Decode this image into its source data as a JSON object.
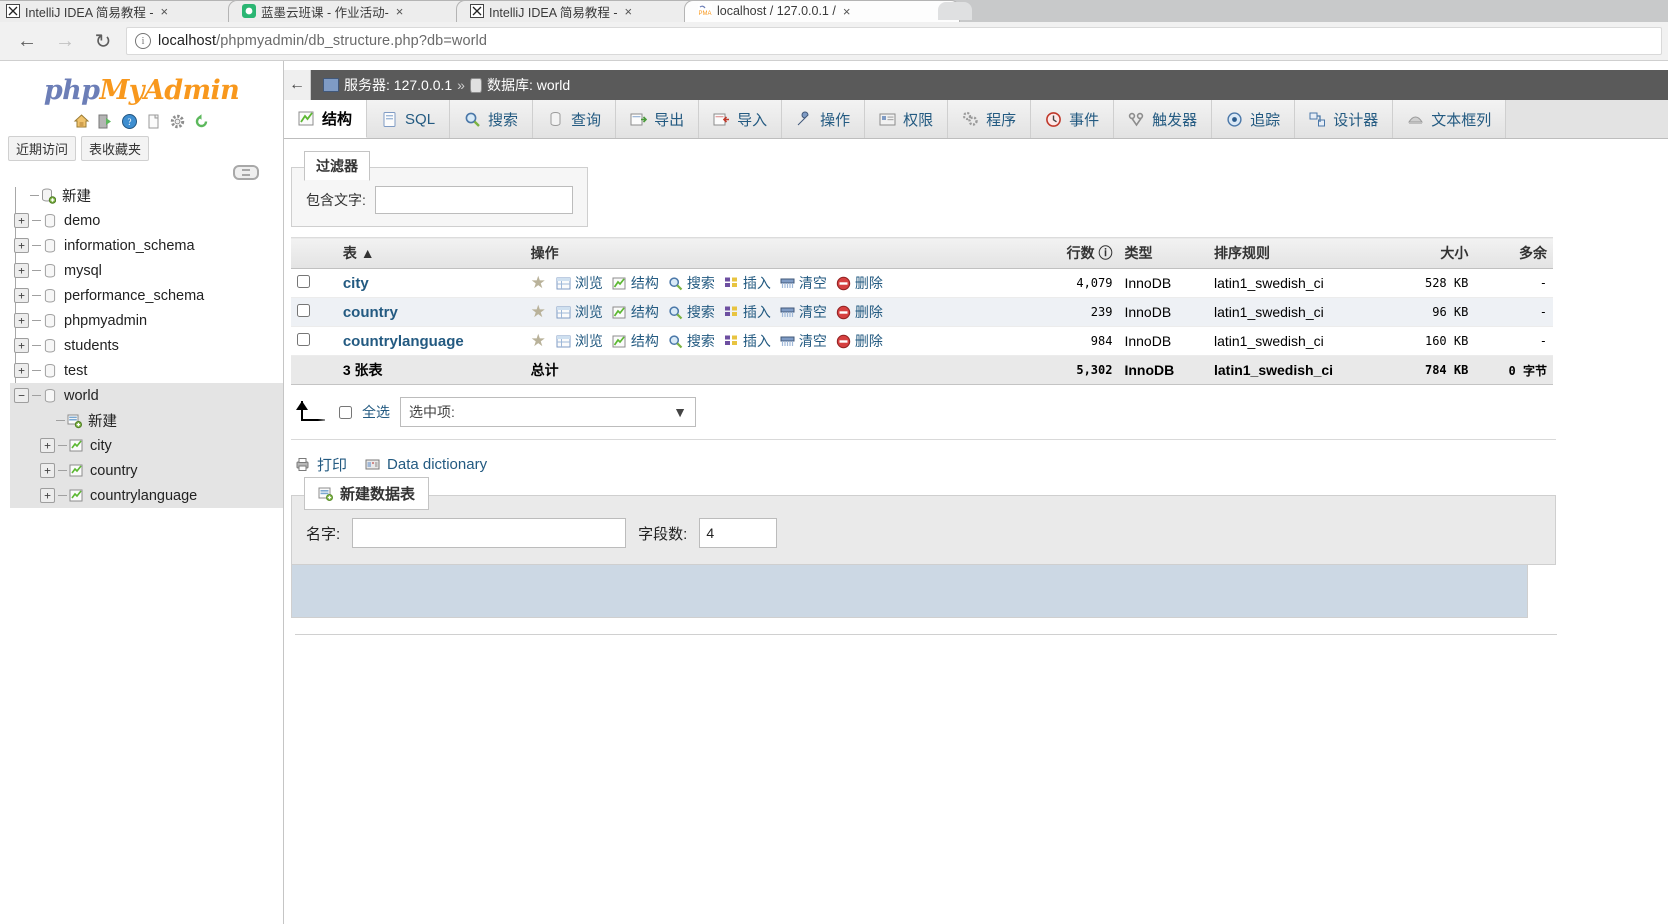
{
  "browser": {
    "tabs": [
      {
        "title": "IntelliJ IDEA 简易教程 -",
        "favicon": "idea-icon",
        "active": false
      },
      {
        "title": "蓝墨云班课 - 作业活动-",
        "favicon": "mosoteach-icon",
        "active": false
      },
      {
        "title": "IntelliJ IDEA 简易教程 -",
        "favicon": "idea-icon",
        "active": false
      },
      {
        "title": "localhost / 127.0.0.1 /",
        "favicon": "pma-icon",
        "active": true
      }
    ],
    "close_label": "×",
    "nav": {
      "back_icon": "back-arrow-icon",
      "forward_icon": "forward-arrow-icon",
      "reload_icon": "reload-icon",
      "info_icon": "info-icon",
      "url_prefix": "localhost",
      "url_rest": "/phpmyadmin/db_structure.php?db=world"
    }
  },
  "sidebar": {
    "logo": {
      "part1": "php",
      "part2": "My",
      "part3": "Admin"
    },
    "quick_icons": [
      "home-icon",
      "logout-icon",
      "docs-icon",
      "wiki-icon",
      "settings-icon",
      "reload-nav-icon"
    ],
    "quick_tabs": [
      {
        "label": "近期访问"
      },
      {
        "label": "表收藏夹"
      }
    ],
    "chain_icon": "chain-icon",
    "tree": [
      {
        "label": "新建",
        "icon": "new-db-icon",
        "expander": "",
        "level": 0,
        "selected": false
      },
      {
        "label": "demo",
        "icon": "db-icon",
        "expander": "+",
        "level": 0,
        "selected": false
      },
      {
        "label": "information_schema",
        "icon": "db-icon",
        "expander": "+",
        "level": 0,
        "selected": false
      },
      {
        "label": "mysql",
        "icon": "db-icon",
        "expander": "+",
        "level": 0,
        "selected": false
      },
      {
        "label": "performance_schema",
        "icon": "db-icon",
        "expander": "+",
        "level": 0,
        "selected": false
      },
      {
        "label": "phpmyadmin",
        "icon": "db-icon",
        "expander": "+",
        "level": 0,
        "selected": false
      },
      {
        "label": "students",
        "icon": "db-icon",
        "expander": "+",
        "level": 0,
        "selected": false
      },
      {
        "label": "test",
        "icon": "db-icon",
        "expander": "+",
        "level": 0,
        "selected": false
      },
      {
        "label": "world",
        "icon": "db-icon",
        "expander": "−",
        "level": 0,
        "selected": true
      },
      {
        "label": "新建",
        "icon": "new-table-icon",
        "expander": "",
        "level": 1,
        "selected": true
      },
      {
        "label": "city",
        "icon": "table-icon",
        "expander": "+",
        "level": 1,
        "selected": true
      },
      {
        "label": "country",
        "icon": "table-icon",
        "expander": "+",
        "level": 1,
        "selected": true
      },
      {
        "label": "countrylanguage",
        "icon": "table-icon",
        "expander": "+",
        "level": 1,
        "selected": true
      }
    ]
  },
  "breadcrumb": {
    "back_icon": "back-arrow-icon",
    "server_icon": "server-icon",
    "server_label": "服务器: 127.0.0.1",
    "separator": "»",
    "db_icon": "database-icon",
    "db_label": "数据库: world"
  },
  "main_tabs": [
    {
      "label": "结构",
      "icon": "structure-icon",
      "active": true
    },
    {
      "label": "SQL",
      "icon": "sql-icon",
      "active": false
    },
    {
      "label": "搜索",
      "icon": "search-icon",
      "active": false
    },
    {
      "label": "查询",
      "icon": "query-icon",
      "active": false
    },
    {
      "label": "导出",
      "icon": "export-icon",
      "active": false
    },
    {
      "label": "导入",
      "icon": "import-icon",
      "active": false
    },
    {
      "label": "操作",
      "icon": "operations-icon",
      "active": false
    },
    {
      "label": "权限",
      "icon": "privileges-icon",
      "active": false
    },
    {
      "label": "程序",
      "icon": "routines-icon",
      "active": false
    },
    {
      "label": "事件",
      "icon": "events-icon",
      "active": false
    },
    {
      "label": "触发器",
      "icon": "triggers-icon",
      "active": false
    },
    {
      "label": "追踪",
      "icon": "tracking-icon",
      "active": false
    },
    {
      "label": "设计器",
      "icon": "designer-icon",
      "active": false
    },
    {
      "label": "文本框列",
      "icon": "central-columns-icon",
      "active": false
    }
  ],
  "filter": {
    "legend": "过滤器",
    "label": "包含文字:",
    "value": ""
  },
  "table": {
    "headers": {
      "check": "",
      "name": "表",
      "sort_icon": "sort-asc-icon",
      "ops": "操作",
      "rows": "行数",
      "rows_help_icon": "help-icon",
      "type": "类型",
      "collation": "排序规则",
      "size": "大小",
      "overhead": "多余"
    },
    "op_labels": [
      {
        "label": "浏览",
        "icon": "browse-icon"
      },
      {
        "label": "结构",
        "icon": "structure-icon"
      },
      {
        "label": "搜索",
        "icon": "search-icon"
      },
      {
        "label": "插入",
        "icon": "insert-icon"
      },
      {
        "label": "清空",
        "icon": "empty-icon"
      },
      {
        "label": "删除",
        "icon": "drop-icon"
      }
    ],
    "favorite_icon": "star-icon",
    "rows": [
      {
        "name": "city",
        "rows": "4,079",
        "type": "InnoDB",
        "collation": "latin1_swedish_ci",
        "size": "528 KB",
        "overhead": "-"
      },
      {
        "name": "country",
        "rows": "239",
        "type": "InnoDB",
        "collation": "latin1_swedish_ci",
        "size": "96 KB",
        "overhead": "-"
      },
      {
        "name": "countrylanguage",
        "rows": "984",
        "type": "InnoDB",
        "collation": "latin1_swedish_ci",
        "size": "160 KB",
        "overhead": "-"
      }
    ],
    "totals": {
      "count": "3 张表",
      "label": "总计",
      "rows": "5,302",
      "type": "InnoDB",
      "collation": "latin1_swedish_ci",
      "size": "784 KB",
      "overhead": "0 字节"
    }
  },
  "selection": {
    "check_all": "全选",
    "with_selected": "选中项:",
    "dropdown_icon": "chevron-down-icon",
    "arrow_icon": "select-all-arrow-icon"
  },
  "links": [
    {
      "label": "打印",
      "icon": "print-icon"
    },
    {
      "label": "Data dictionary",
      "icon": "data-dictionary-icon"
    }
  ],
  "new_table": {
    "legend": "新建数据表",
    "legend_icon": "new-table-icon",
    "name_label": "名字:",
    "name_value": "",
    "columns_label": "字段数:",
    "columns_value": "4"
  },
  "colors": {
    "link": "#235a81",
    "breadcrumb_bg": "#5a5a5a",
    "accent_orange": "#f8981d",
    "accent_blue": "#6c7eb7",
    "row_alt": "#eef1f5",
    "bottom_panel": "#ccd8e4"
  }
}
